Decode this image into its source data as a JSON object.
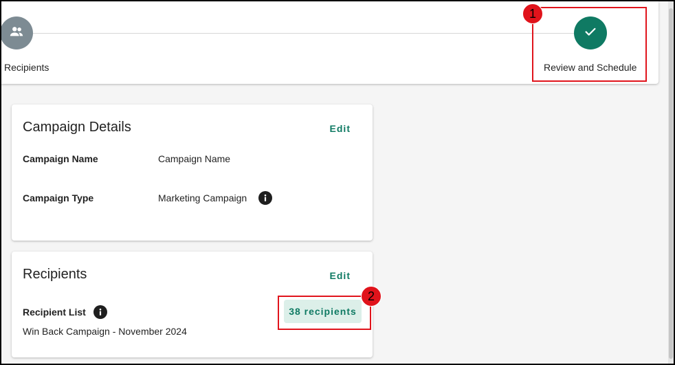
{
  "stepper": {
    "steps": [
      {
        "label": "Recipients",
        "icon": "people-icon",
        "color": "#7d8b93"
      },
      {
        "label": "Review and Schedule",
        "icon": "check-icon",
        "color": "#0f7a63"
      }
    ]
  },
  "annotations": {
    "marker1": "1",
    "marker2": "2",
    "color": "#e0131b"
  },
  "campaign_details": {
    "title": "Campaign Details",
    "edit_label": "Edit",
    "name_label": "Campaign Name",
    "name_value": "Campaign Name",
    "type_label": "Campaign Type",
    "type_value": "Marketing Campaign"
  },
  "recipients_card": {
    "title": "Recipients",
    "edit_label": "Edit",
    "list_label": "Recipient List",
    "list_value": "Win Back Campaign - November 2024",
    "count_badge": "38 recipients"
  },
  "theme": {
    "accent": "#0f7a63",
    "badge_bg": "#dcefe9"
  }
}
